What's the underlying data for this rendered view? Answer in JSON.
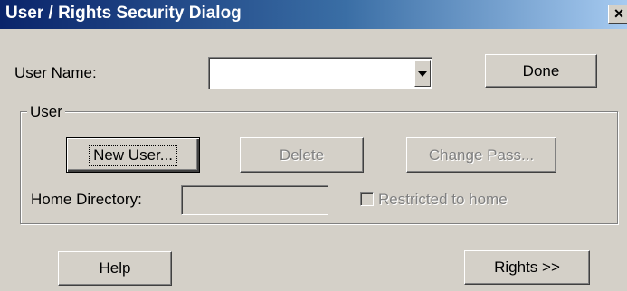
{
  "window": {
    "title": "User / Rights Security Dialog",
    "close_glyph": "×"
  },
  "user_name": {
    "label": "User Name:",
    "value": "",
    "dropdown_icon": "chevron-down-icon"
  },
  "buttons": {
    "done": "Done",
    "new_user": "New User...",
    "delete": "Delete",
    "change_pass": "Change Pass...",
    "help": "Help",
    "rights": "Rights >>"
  },
  "group": {
    "legend": "User",
    "home_directory_label": "Home Directory:",
    "home_directory_value": "",
    "restricted_label": "Restricted to home",
    "restricted_checked": false
  },
  "colors": {
    "titlebar_start": "#0a246a",
    "titlebar_end": "#a6caf0",
    "face": "#d4d0c8",
    "disabled_text": "#808080"
  }
}
